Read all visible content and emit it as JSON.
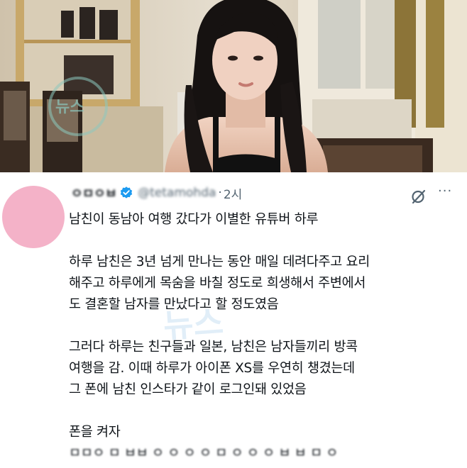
{
  "photo": {
    "description_icon": "photo-of-woman",
    "watermark_small": "뉴스"
  },
  "tweet": {
    "display_name": "ㅇㅁㅇㅂ",
    "handle": "@tetamohda",
    "separator": "·",
    "time": "2시",
    "more": "···",
    "lines": [
      "남친이 동남아 여행 갔다가 이별한 유튜버 하루",
      "",
      "하루 남친은 3년 넘게 만나는 동안 매일 데려다주고 요리",
      "해주고 하루에게 목숨을 바칠 정도로 희생해서 주변에서",
      "도 결혼할 남자를 만났다고 할 정도였음",
      "",
      "그러다 하루는 친구들과 일본, 남친은 남자들끼리 방콕",
      "여행을 감. 이때 하루가 아이폰 XS를 우연히 챙겼는데",
      "그 폰에 남친 인스타가 같이 로그인돼 있었음",
      "",
      "폰을 켜자",
      "ㅁㅁㅇ ㅁ ㅂㅂ ㅇ ㅇ ㅇ ㅇ ㅁ ㅇ ㅇ ㅇ ㅂ ㅂ ㅁ ㅇ"
    ],
    "watermark": "뉴스"
  }
}
